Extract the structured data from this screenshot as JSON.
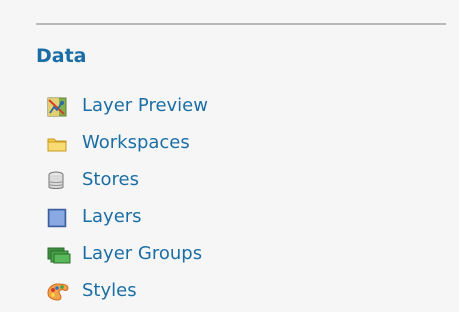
{
  "sidebar": {
    "section_title": "Data",
    "items": [
      {
        "label": "Layer Preview",
        "icon": "layer-preview-icon"
      },
      {
        "label": "Workspaces",
        "icon": "workspaces-folder-icon"
      },
      {
        "label": "Stores",
        "icon": "stores-database-icon"
      },
      {
        "label": "Layers",
        "icon": "layers-icon"
      },
      {
        "label": "Layer Groups",
        "icon": "layer-groups-icon"
      },
      {
        "label": "Styles",
        "icon": "styles-palette-icon"
      }
    ]
  },
  "colors": {
    "link": "#1b6ea5",
    "background": "#f6f6f6",
    "divider": "#b9bcb6"
  }
}
